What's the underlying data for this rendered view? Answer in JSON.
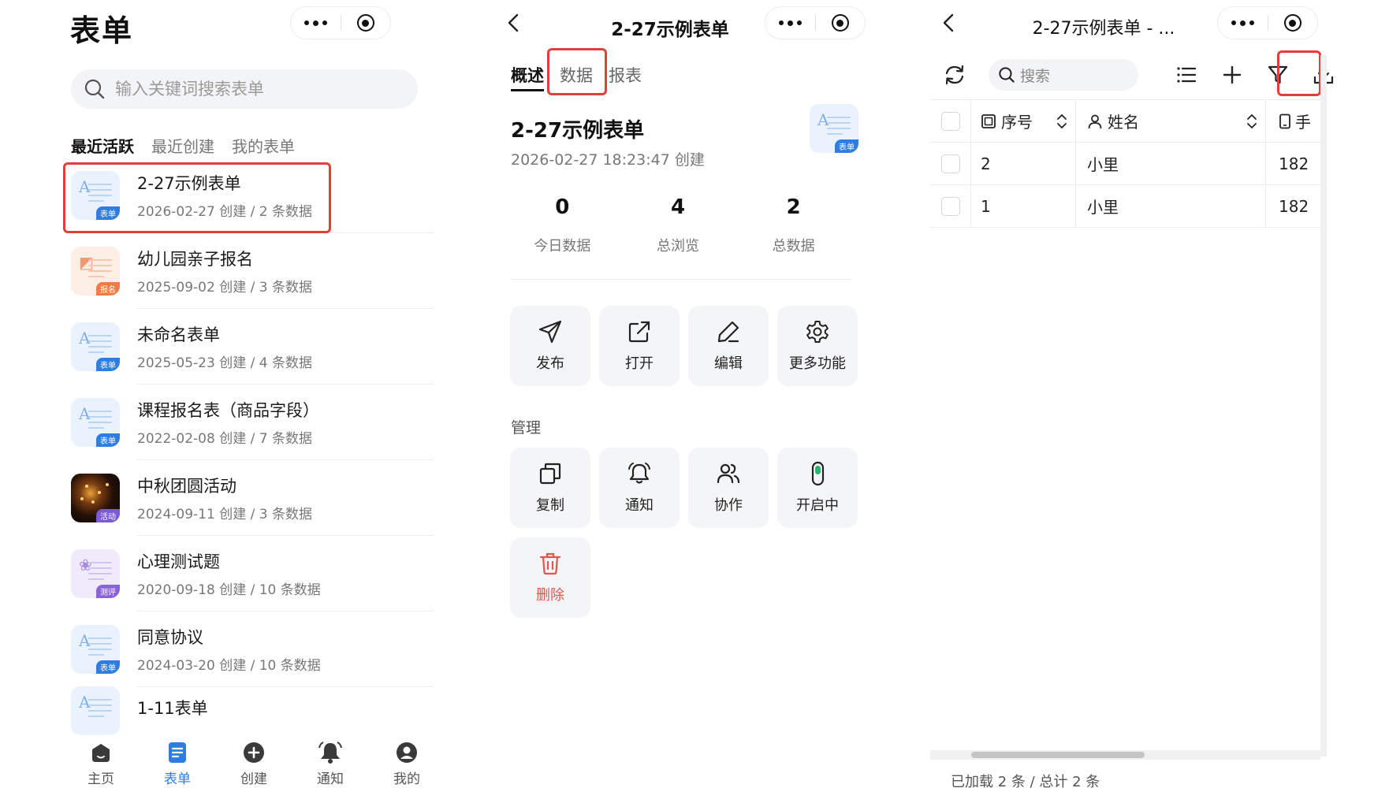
{
  "panel1": {
    "title": "表单",
    "search_placeholder": "输入关键词搜索表单",
    "tabs": [
      "最近活跃",
      "最近创建",
      "我的表单"
    ],
    "forms": [
      {
        "title": "2-27示例表单",
        "meta": "2026-02-27 创建 / 2 条数据",
        "badge": "表单",
        "style": "blue"
      },
      {
        "title": "幼儿园亲子报名",
        "meta": "2025-09-02 创建 / 3 条数据",
        "badge": "报名",
        "style": "orange"
      },
      {
        "title": "未命名表单",
        "meta": "2025-05-23 创建 / 4 条数据",
        "badge": "表单",
        "style": "blue"
      },
      {
        "title": "课程报名表（商品字段）",
        "meta": "2022-02-08 创建 / 7 条数据",
        "badge": "表单",
        "style": "blue"
      },
      {
        "title": "中秋团圆活动",
        "meta": "2024-09-11 创建 / 3 条数据",
        "badge": "活动",
        "style": "photo"
      },
      {
        "title": "心理测试题",
        "meta": "2020-09-18 创建 / 10 条数据",
        "badge": "测评",
        "style": "purple"
      },
      {
        "title": "同意协议",
        "meta": "2024-03-20 创建 / 10 条数据",
        "badge": "表单",
        "style": "blue"
      },
      {
        "title": "1-11表单",
        "meta": "",
        "badge": "",
        "style": "blue"
      }
    ],
    "nav": [
      "主页",
      "表单",
      "创建",
      "通知",
      "我的"
    ]
  },
  "panel2": {
    "title": "2-27示例表单",
    "tabs": [
      "概述",
      "数据",
      "报表"
    ],
    "form_name": "2-27示例表单",
    "created": "2026-02-27 18:23:47 创建",
    "icon_badge": "表单",
    "stats": [
      {
        "value": "0",
        "label": "今日数据"
      },
      {
        "value": "4",
        "label": "总浏览"
      },
      {
        "value": "2",
        "label": "总数据"
      }
    ],
    "actions": [
      "发布",
      "打开",
      "编辑",
      "更多功能"
    ],
    "section_manage": "管理",
    "manage": [
      "复制",
      "通知",
      "协作",
      "开启中"
    ],
    "delete": "删除"
  },
  "panel3": {
    "title": "2-27示例表单 - ...",
    "search_placeholder": "搜索",
    "columns": [
      "序号",
      "姓名",
      "手"
    ],
    "rows": [
      {
        "seq": "2",
        "name": "小里",
        "phone": "182"
      },
      {
        "seq": "1",
        "name": "小里",
        "phone": "182"
      }
    ],
    "footer": "已加载 2 条 / 总计 2 条"
  },
  "colors": {
    "accent": "#2f7de1",
    "highlight": "#e0403a",
    "danger": "#e0554f"
  }
}
